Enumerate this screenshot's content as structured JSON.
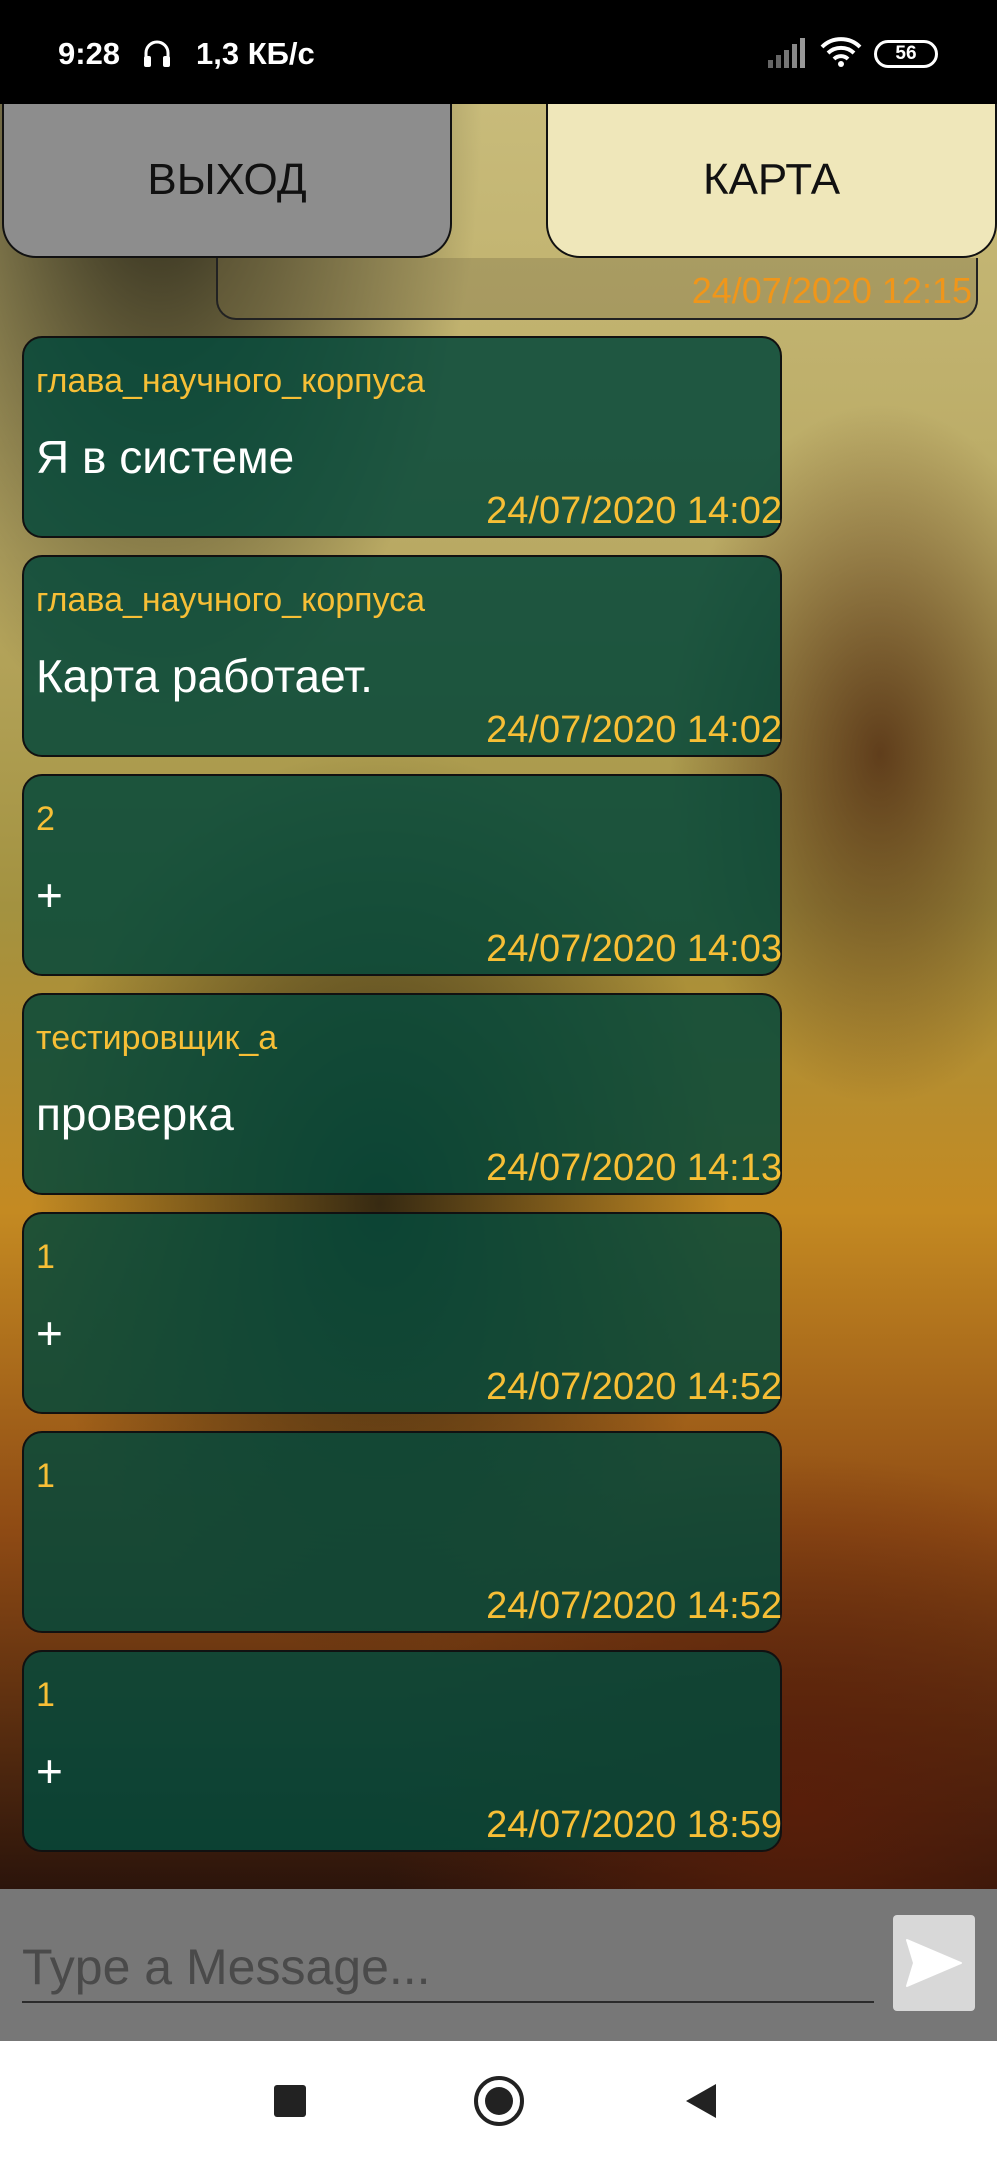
{
  "status_bar": {
    "time": "9:28",
    "speed": "1,3 КБ/с",
    "battery": "56",
    "icons": [
      "headphones-icon",
      "signal-icon",
      "wifi-icon",
      "battery-icon"
    ]
  },
  "header": {
    "exit_label": "ВЫХОД",
    "map_label": "КАРТА"
  },
  "partial_message": {
    "time": "24/07/2020  12:15"
  },
  "messages": [
    {
      "author": "глава_научного_корпуса",
      "text": "Я в системе",
      "time": "24/07/2020  14:02"
    },
    {
      "author": "глава_научного_корпуса",
      "text": "Карта работает.",
      "time": "24/07/2020  14:02"
    },
    {
      "author": "2",
      "text": "+",
      "time": "24/07/2020  14:03"
    },
    {
      "author": "тестировщик_а",
      "text": "проверка",
      "time": "24/07/2020  14:13"
    },
    {
      "author": "1",
      "text": "+",
      "time": "24/07/2020  14:52"
    },
    {
      "author": "1",
      "text": "",
      "time": "24/07/2020  14:52"
    },
    {
      "author": "1",
      "text": "+",
      "time": "24/07/2020  18:59"
    }
  ],
  "composer": {
    "placeholder": "Type a Message...",
    "send_icon": "send-icon"
  },
  "nav": {
    "icons": [
      "recent-apps-icon",
      "home-icon",
      "back-icon"
    ]
  },
  "colors": {
    "bubble": "#05483a",
    "author_text": "#f7bf36",
    "partial_time": "#f0961a",
    "exit_button": "#8d8d8d",
    "map_button": "#efe7ba"
  }
}
